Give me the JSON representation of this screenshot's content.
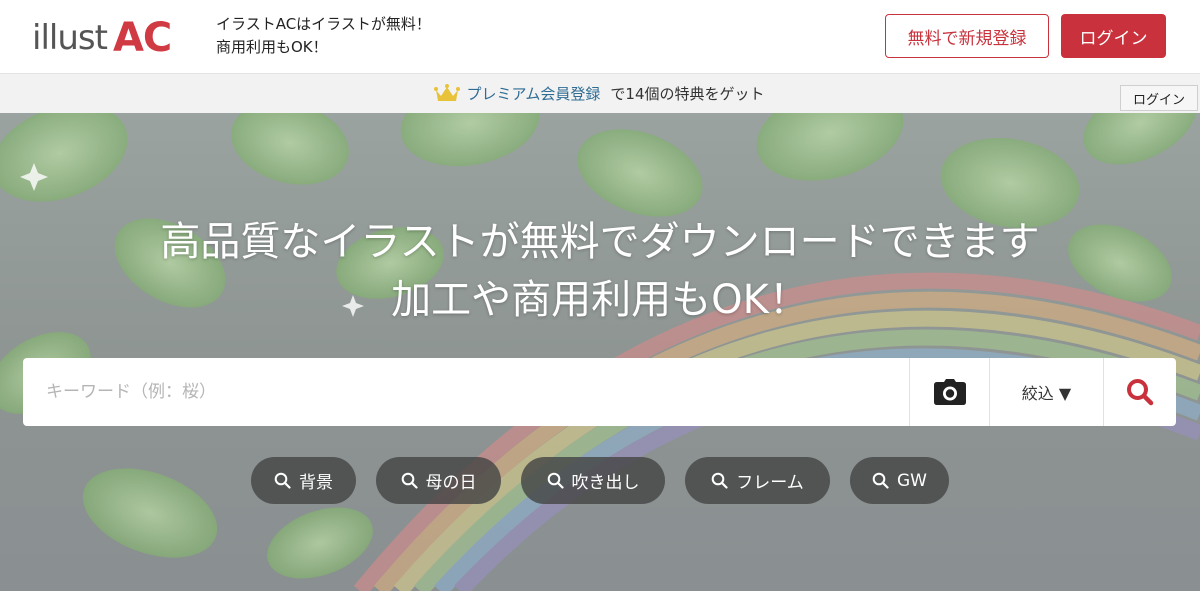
{
  "header": {
    "logo_illust": "illust",
    "logo_ac": "AC",
    "tagline_line1": "イラストACはイラストが無料！",
    "tagline_line2": "商用利用もOK！",
    "register_label": "無料で新規登録",
    "login_label": "ログイン"
  },
  "premium_bar": {
    "icon": "crown-icon",
    "link_label": "プレミアム会員登録",
    "text": "で14個の特典をゲット"
  },
  "tooltip": {
    "label": "ログイン"
  },
  "hero": {
    "title_line1": "高品質なイラストが無料でダウンロードできます",
    "title_line2": "加工や商用利用もOK！"
  },
  "search": {
    "placeholder": "キーワード（例：桜）",
    "value": "",
    "camera_icon": "camera-icon",
    "filter_label": "絞込 ▼",
    "search_icon": "search-icon"
  },
  "tags": [
    {
      "label": "背景"
    },
    {
      "label": "母の日"
    },
    {
      "label": "吹き出し"
    },
    {
      "label": "フレーム"
    },
    {
      "label": "GW"
    }
  ],
  "colors": {
    "brand_red": "#c9323c",
    "premium_link": "#2f6c94",
    "crown": "#e8c33a",
    "tag_bg": "#464646"
  }
}
